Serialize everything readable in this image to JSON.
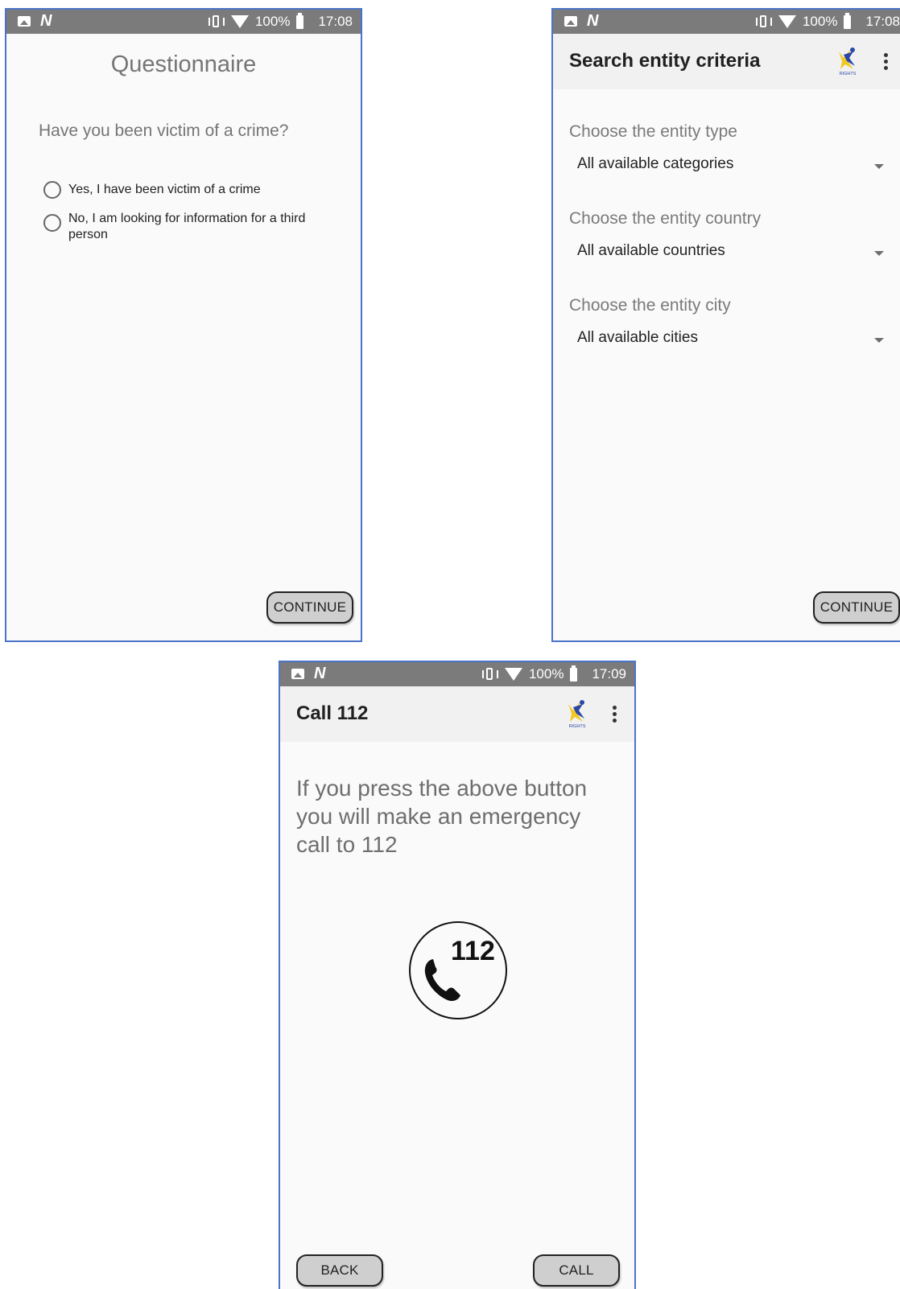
{
  "screens": {
    "questionnaire": {
      "status": {
        "battery": "100%",
        "time": "17:08"
      },
      "title": "Questionnaire",
      "question": "Have you been victim of a crime?",
      "options": [
        "Yes, I have been victim of a crime",
        "No, I am looking for information for a third person"
      ],
      "continue_label": "CONTINUE"
    },
    "search": {
      "status": {
        "battery": "100%",
        "time": "17:08"
      },
      "title": "Search entity criteria",
      "fields": [
        {
          "label": "Choose the entity type",
          "value": "All available categories"
        },
        {
          "label": "Choose the entity country",
          "value": "All available countries"
        },
        {
          "label": "Choose the entity city",
          "value": "All available cities"
        }
      ],
      "continue_label": "CONTINUE"
    },
    "call": {
      "status": {
        "battery": "100%",
        "time": "17:09"
      },
      "title": "Call 112",
      "message": "If you press the above button you will make an emergency call to 112",
      "emergency_number": "112",
      "back_label": "BACK",
      "call_label": "CALL"
    }
  },
  "logo_text": "RIGHTS",
  "colors": {
    "statusbar": "#7b7b7b",
    "frame_border": "#4a74c9",
    "button_fill": "#cfcfcf"
  }
}
